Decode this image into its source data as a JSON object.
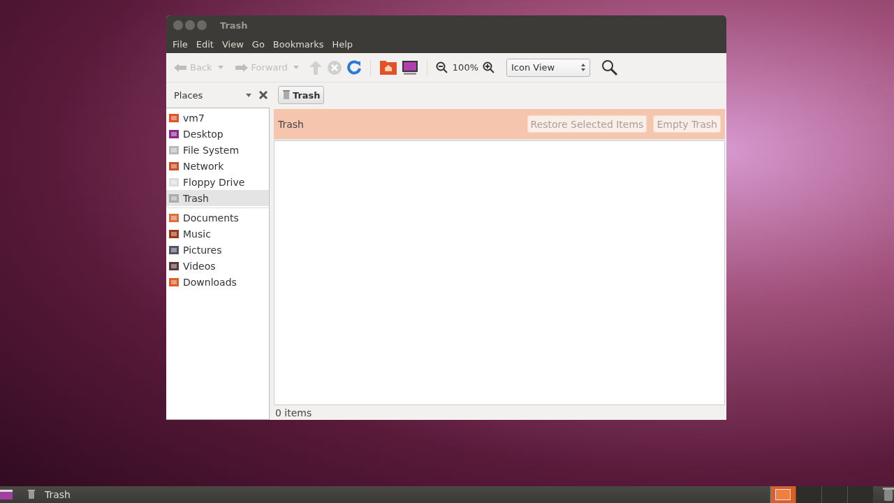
{
  "window": {
    "title": "Trash"
  },
  "menu": [
    "File",
    "Edit",
    "View",
    "Go",
    "Bookmarks",
    "Help"
  ],
  "toolbar": {
    "back": {
      "label": "Back",
      "disabled": true
    },
    "forward": {
      "label": "Forward",
      "disabled": true
    },
    "up_disabled": true,
    "stop_disabled": true,
    "zoom": "100%",
    "view_select": "Icon View"
  },
  "sidebar": {
    "title": "Places",
    "items": [
      {
        "label": "vm7",
        "kind": "home",
        "selected": false
      },
      {
        "label": "Desktop",
        "kind": "desktop",
        "selected": false
      },
      {
        "label": "File System",
        "kind": "drive",
        "selected": false
      },
      {
        "label": "Network",
        "kind": "network",
        "selected": false
      },
      {
        "label": "Floppy Drive",
        "kind": "floppy",
        "selected": false
      },
      {
        "label": "Trash",
        "kind": "trash",
        "selected": true
      }
    ],
    "bookmarks": [
      {
        "label": "Documents",
        "kind": "documents",
        "selected": false
      },
      {
        "label": "Music",
        "kind": "music",
        "selected": false
      },
      {
        "label": "Pictures",
        "kind": "pictures",
        "selected": false
      },
      {
        "label": "Videos",
        "kind": "videos",
        "selected": false
      },
      {
        "label": "Downloads",
        "kind": "downloads",
        "selected": false
      }
    ]
  },
  "path_button": "Trash",
  "trash_bar": {
    "label": "Trash",
    "buttons": [
      {
        "label": "Restore Selected Items",
        "disabled": true
      },
      {
        "label": "Empty Trash",
        "disabled": true
      }
    ]
  },
  "status_bar": "0 items",
  "taskbar": {
    "task": "Trash",
    "workspaces": [
      {
        "selected": true
      },
      {
        "selected": false
      },
      {
        "selected": false
      },
      {
        "selected": false
      }
    ]
  }
}
